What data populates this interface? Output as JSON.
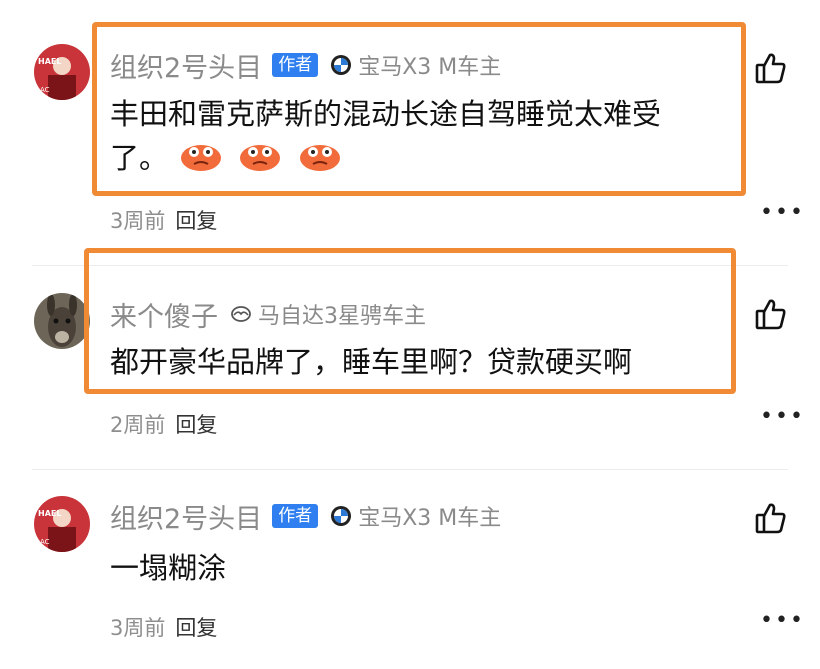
{
  "comments": [
    {
      "username": "组织2号头目",
      "author_badge": "作者",
      "car": "宝马X3 M车主",
      "brand_icon": "bmw-logo-icon",
      "text_line1": "丰田和雷克萨斯的混动长途自驾睡觉太难受",
      "text_line2": "了。",
      "emoji_icon": "sweat-face-icon",
      "time": "3周前",
      "reply": "回复"
    },
    {
      "username": "来个傻子",
      "car": "马自达3星骋车主",
      "brand_icon": "mazda-logo-icon",
      "text": "都开豪华品牌了，睡车里啊？贷款硬买啊",
      "time": "2周前",
      "reply": "回复"
    },
    {
      "username": "组织2号头目",
      "author_badge": "作者",
      "car": "宝马X3 M车主",
      "brand_icon": "bmw-logo-icon",
      "text": "一塌糊涂",
      "time": "3周前",
      "reply": "回复"
    }
  ],
  "icons": {
    "like": "thumbs-up-icon",
    "more": "more-dots-icon"
  },
  "colors": {
    "highlight": "#f08a35",
    "badge": "#2f7ff0"
  }
}
